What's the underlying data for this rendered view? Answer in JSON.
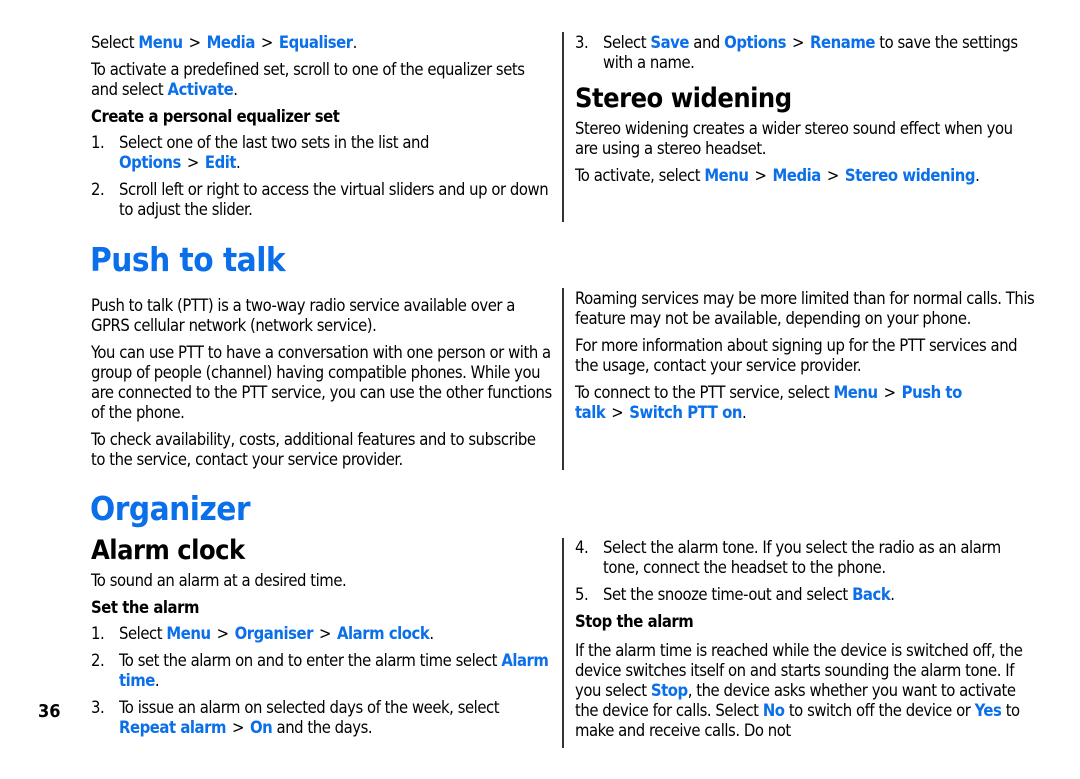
{
  "page_number": "36",
  "colors": {
    "link": "#0a6fe8",
    "text": "#000000",
    "divider": "#333333"
  },
  "equalizer": {
    "path_intro": "Select",
    "path": [
      "Menu",
      "Media",
      "Equaliser"
    ],
    "activate_text": "To activate a predefined set, scroll to one of the equalizer sets and select",
    "activate_link": "Activate",
    "subheading": "Create a personal equalizer set",
    "steps": [
      {
        "num": "1.",
        "text": "Select one of the last two sets in the list and",
        "links": [
          "Options",
          "Edit"
        ]
      },
      {
        "num": "2.",
        "text": "Scroll left or right to access the virtual sliders and up or down to adjust the slider."
      },
      {
        "num": "3.",
        "pre": "Select",
        "link1": "Save",
        "mid": "and",
        "links": [
          "Options",
          "Rename"
        ],
        "post": "to save the settings with a name."
      }
    ]
  },
  "stereo": {
    "heading": "Stereo widening",
    "body": "Stereo widening creates a wider stereo sound effect when you are using a stereo headset.",
    "activate_intro": "To activate, select",
    "path": [
      "Menu",
      "Media",
      "Stereo widening"
    ]
  },
  "ptt": {
    "heading": "Push to talk",
    "paragraphs": [
      "Push to talk (PTT) is a two-way radio service available over a GPRS cellular network (network service).",
      "You can use PTT to have a conversation with one person or with a group of people (channel) having compatible phones. While you are connected to the PTT service, you can use the other functions of the phone.",
      "To check availability, costs, additional features and to subscribe to the service, contact your service provider.",
      "Roaming services may be more limited than for normal calls. This feature may not be available, depending on your phone.",
      "For more information about signing up for the PTT services and the usage, contact your service provider."
    ],
    "connect_intro": "To connect to the PTT service, select",
    "path": [
      "Menu",
      "Push to talk",
      "Switch PTT on"
    ]
  },
  "organizer": {
    "heading": "Organizer",
    "alarm": {
      "heading": "Alarm clock",
      "intro": "To sound an alarm at a desired time.",
      "set_heading": "Set the alarm",
      "steps": [
        {
          "num": "1.",
          "pre": "Select",
          "links": [
            "Menu",
            "Organiser",
            "Alarm clock"
          ]
        },
        {
          "num": "2.",
          "pre": "To set the alarm on and to enter the alarm time select",
          "links": [
            "Alarm time"
          ]
        },
        {
          "num": "3.",
          "pre": "To issue an alarm on selected days of the week, select",
          "links": [
            "Repeat alarm",
            "On"
          ],
          "post": "and the days."
        },
        {
          "num": "4.",
          "pre": "Select the alarm tone. If you select the radio as an alarm tone, connect the headset to the phone."
        },
        {
          "num": "5.",
          "pre": "Set the snooze time-out and select",
          "links": [
            "Back"
          ]
        }
      ],
      "stop_heading": "Stop the alarm",
      "stop": {
        "t1": "If the alarm time is reached while the device is switched off, the device switches itself on and starts sounding the alarm tone. If you select",
        "l1": "Stop",
        "t2": ", the device asks whether you want to activate the device for calls. Select",
        "l2": "No",
        "t3": "to switch off the device or",
        "l3": "Yes",
        "t4": "to make and receive calls. Do not"
      }
    }
  },
  "separator": ">",
  "period": "."
}
